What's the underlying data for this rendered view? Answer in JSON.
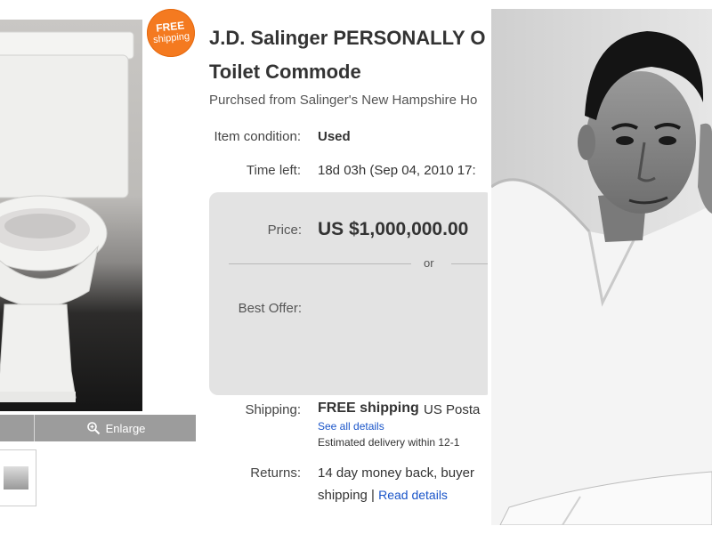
{
  "listing": {
    "badge": {
      "line1": "FREE",
      "line2": "shipping",
      "color": "#f47a20"
    },
    "enlarge_label": "Enlarge",
    "title_line1": "J.D. Salinger PERSONALLY O",
    "title_line2": "Toilet Commode",
    "subtitle": "Purchsed from Salinger's New Hampshire Ho",
    "item_condition": {
      "label": "Item condition:",
      "value": "Used"
    },
    "time_left": {
      "label": "Time left:",
      "value": "18d 03h (Sep 04, 2010 17:"
    },
    "price": {
      "label": "Price:",
      "value": "US $1,000,000.00",
      "or": "or",
      "best_offer_label": "Best Offer:"
    },
    "shipping": {
      "label": "Shipping:",
      "value": "FREE shipping",
      "method": "US Posta",
      "see_all": "See all details",
      "estimated": "Estimated delivery within 12-1"
    },
    "returns": {
      "label": "Returns:",
      "line1": "14 day money back, buyer",
      "line2": "shipping | ",
      "read_details": "Read details"
    },
    "link_color": "#1a55c9"
  },
  "images": {
    "product": "toilet-photo",
    "portrait": "black-and-white-portrait-photo"
  }
}
